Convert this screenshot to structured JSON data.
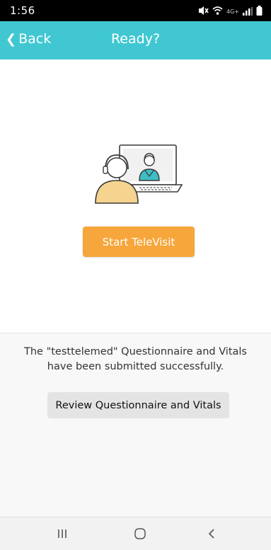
{
  "status_bar": {
    "time": "1:56",
    "network_label": "4G+"
  },
  "header": {
    "back_label": "Back",
    "title": "Ready?"
  },
  "main": {
    "illustration_icon": "telemedicine-video-call-illustration",
    "start_button_label": "Start TeleVisit"
  },
  "footer": {
    "message": "The  \"testtelemed\" Questionnaire and Vitals have been submitted successfully.",
    "review_button_label": "Review Questionnaire and Vitals"
  },
  "colors": {
    "header_bg": "#40c7d2",
    "start_button_bg": "#f6a63a",
    "doctor_accent": "#3fbcc6",
    "patient_body": "#f6d48f"
  },
  "android_nav": {
    "icons": [
      "recent-apps-icon",
      "home-icon",
      "back-icon"
    ]
  }
}
